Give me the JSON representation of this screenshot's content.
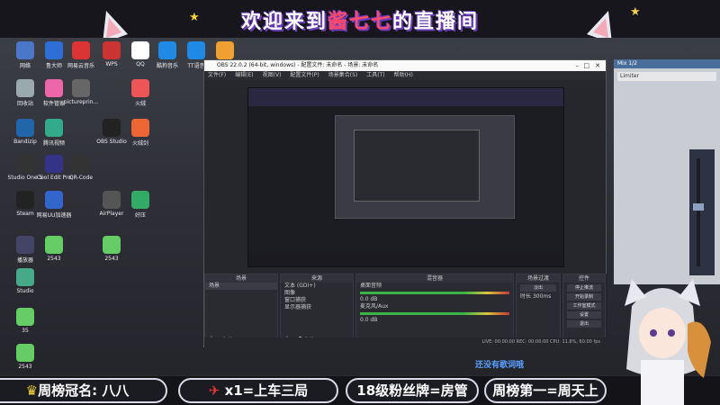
{
  "banner": {
    "title_a": "欢迎来到",
    "title_b": "酱七七",
    "title_c": "的直播间"
  },
  "desktop_icons": [
    {
      "label": "网络",
      "color": "#4a78c8"
    },
    {
      "label": "鲁大师",
      "color": "#2e6fd6"
    },
    {
      "label": "网易云音乐",
      "color": "#d33"
    },
    {
      "label": "WPS",
      "color": "#c33"
    },
    {
      "label": "QQ",
      "color": "#fff"
    },
    {
      "label": "酷狗音乐",
      "color": "#1e8ae6"
    },
    {
      "label": "TT语音",
      "color": "#1e8ae6"
    },
    {
      "label": "迅雷",
      "color": "#f0a030"
    },
    {
      "label": "回收站",
      "color": "#9aa"
    },
    {
      "label": "软件管家",
      "color": "#e6a"
    },
    {
      "label": "pictureprin...",
      "color": "#666"
    },
    {
      "label": "火绒",
      "color": "#e55"
    },
    {
      "label": "腾讯视频",
      "color": "#3a8"
    },
    {
      "label": "Bandizip",
      "color": "#26a"
    },
    {
      "label": "OBS Studio",
      "color": "#222"
    },
    {
      "label": "火绒剑",
      "color": "#e63"
    },
    {
      "label": "Studio One 5",
      "color": "#333"
    },
    {
      "label": "Cool Edit Pro",
      "color": "#338"
    },
    {
      "label": "QR-Code",
      "color": "#333"
    },
    {
      "label": "Steam",
      "color": "#222"
    },
    {
      "label": "网易UU加速器",
      "color": "#36c"
    },
    {
      "label": "AirPlayer",
      "color": "#555"
    },
    {
      "label": "好压",
      "color": "#3a6"
    },
    {
      "label": "播放器",
      "color": "#446"
    },
    {
      "label": "2543",
      "color": "#6c6"
    },
    {
      "label": "2543",
      "color": "#6c6"
    },
    {
      "label": "Studio",
      "color": "#4a8"
    },
    {
      "label": "35",
      "color": "#6c6"
    },
    {
      "label": "2543",
      "color": "#6c6"
    }
  ],
  "obs": {
    "title": "OBS 22.0.2 (64-bit, windows) - 配置文件: 未命名 - 场景: 未命名",
    "menu": [
      "文件(F)",
      "编辑(E)",
      "视图(V)",
      "配置文件(P)",
      "场景集合(S)",
      "工具(T)",
      "帮助(H)"
    ],
    "docks": {
      "scenes": {
        "header": "场景",
        "items": [
          "场景"
        ]
      },
      "sources": {
        "header": "来源",
        "items": [
          "文本 (GDI+)",
          "图像",
          "窗口捕获",
          "显示器捕获"
        ]
      },
      "mixer": {
        "header": "混音器",
        "items": [
          "桌面音频",
          "麦克风/Aux"
        ],
        "levels": [
          "0.0 dB",
          "0.0 dB"
        ]
      },
      "transitions": {
        "header": "场景过渡",
        "type": "淡出",
        "duration_label": "时长",
        "duration": "300ms"
      },
      "controls": {
        "header": "控件",
        "buttons": [
          "停止推流",
          "开始录制",
          "工作室模式",
          "设置",
          "退出"
        ]
      }
    },
    "status": "LIVE: 00:00:00   REC: 00:00:00   CPU: 11.8%, 60.00 fps"
  },
  "mixer_panel": {
    "title": "Mix 1/2",
    "label": "Limiter"
  },
  "note_text": "还没有歌词哦",
  "bottom": {
    "weekly_label": "周榜冠名:",
    "weekly_name": "八八",
    "x1": "x1=上车三局",
    "fan": "18级粉丝牌=房管",
    "week1": "周榜第一=周天上车"
  }
}
